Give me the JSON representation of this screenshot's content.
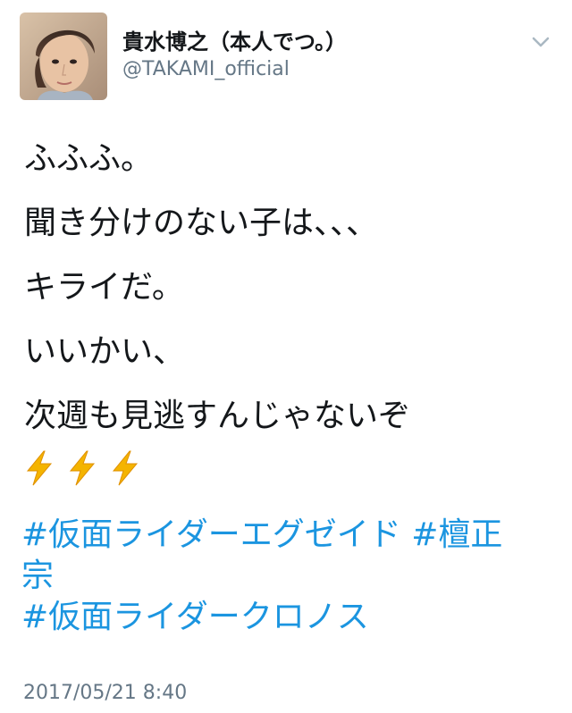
{
  "user": {
    "display_name": "貴水博之（本人でつ。）",
    "handle": "@TAKAMI_official",
    "avatar_icon": "profile-photo"
  },
  "tweet": {
    "lines": [
      "ふふふ。",
      "聞き分けのない子は、、、",
      "キライだ。",
      "いいかい、",
      "次週も見逃すんじゃないぞ"
    ],
    "emoji": [
      "⚡",
      "⚡",
      "⚡"
    ],
    "hashtags_line1": [
      "#仮面ライダーエグゼイド",
      "#檀正"
    ],
    "hashtags_line2": "宗",
    "hashtags_line3": "#仮面ライダークロノス",
    "timestamp": "2017/05/21 8:40"
  },
  "colors": {
    "text": "#14171a",
    "secondary": "#657786",
    "link": "#1b95e0",
    "bolt": "#f4b400"
  },
  "icons": {
    "menu": "chevron-down-icon"
  }
}
